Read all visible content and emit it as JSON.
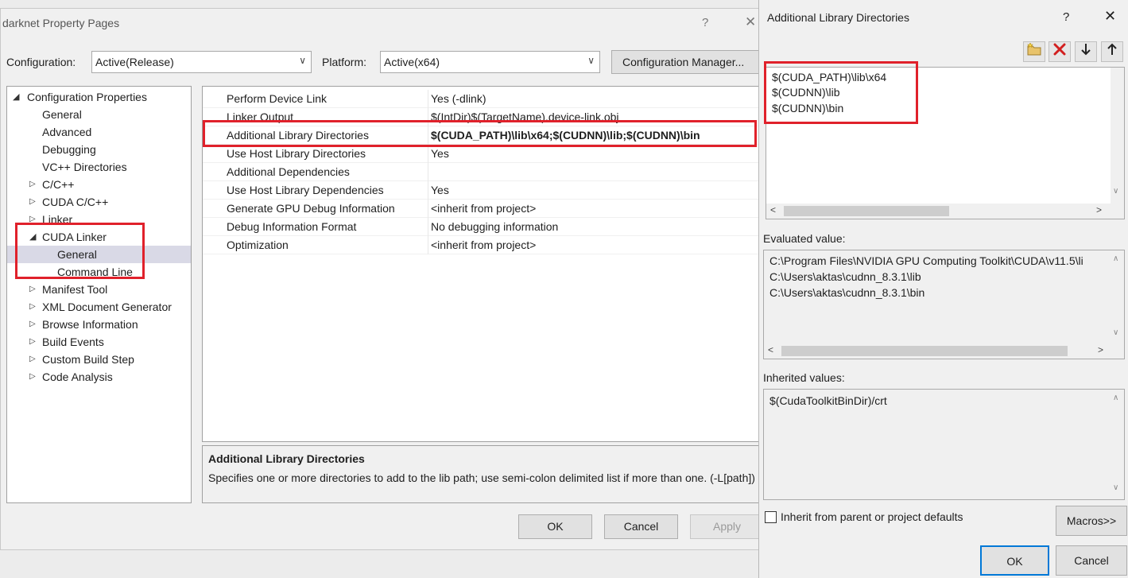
{
  "property_pages": {
    "title": "darknet Property Pages",
    "help": "?",
    "close": "✕",
    "config_label": "Configuration:",
    "config_value": "Active(Release)",
    "platform_label": "Platform:",
    "platform_value": "Active(x64)",
    "config_manager": "Configuration Manager...",
    "tree": [
      {
        "label": "Configuration Properties",
        "indent": 0,
        "toggle": "expanded"
      },
      {
        "label": "General",
        "indent": 1,
        "toggle": "none"
      },
      {
        "label": "Advanced",
        "indent": 1,
        "toggle": "none"
      },
      {
        "label": "Debugging",
        "indent": 1,
        "toggle": "none"
      },
      {
        "label": "VC++ Directories",
        "indent": 1,
        "toggle": "none"
      },
      {
        "label": "C/C++",
        "indent": 1,
        "toggle": "collapsed"
      },
      {
        "label": "CUDA C/C++",
        "indent": 1,
        "toggle": "collapsed"
      },
      {
        "label": "Linker",
        "indent": 1,
        "toggle": "collapsed"
      },
      {
        "label": "CUDA Linker",
        "indent": 1,
        "toggle": "expanded"
      },
      {
        "label": "General",
        "indent": 2,
        "toggle": "none",
        "selected": true
      },
      {
        "label": "Command Line",
        "indent": 2,
        "toggle": "none"
      },
      {
        "label": "Manifest Tool",
        "indent": 1,
        "toggle": "collapsed"
      },
      {
        "label": "XML Document Generator",
        "indent": 1,
        "toggle": "collapsed"
      },
      {
        "label": "Browse Information",
        "indent": 1,
        "toggle": "collapsed"
      },
      {
        "label": "Build Events",
        "indent": 1,
        "toggle": "collapsed"
      },
      {
        "label": "Custom Build Step",
        "indent": 1,
        "toggle": "collapsed"
      },
      {
        "label": "Code Analysis",
        "indent": 1,
        "toggle": "collapsed"
      }
    ],
    "properties": [
      {
        "name": "Perform Device Link",
        "value": "Yes (-dlink)"
      },
      {
        "name": "Linker Output",
        "value": "$(IntDir)$(TargetName).device-link.obj"
      },
      {
        "name": "Additional Library Directories",
        "value": "$(CUDA_PATH)\\lib\\x64;$(CUDNN)\\lib;$(CUDNN)\\bin",
        "bold": true
      },
      {
        "name": "Use Host Library Directories",
        "value": "Yes"
      },
      {
        "name": "Additional Dependencies",
        "value": ""
      },
      {
        "name": "Use Host Library Dependencies",
        "value": "Yes"
      },
      {
        "name": "Generate GPU Debug Information",
        "value": "<inherit from project>"
      },
      {
        "name": "Debug Information Format",
        "value": "No debugging information"
      },
      {
        "name": "Optimization",
        "value": "<inherit from project>"
      }
    ],
    "description": {
      "title": "Additional Library Directories",
      "text": "Specifies one or more directories to add to the lib path; use semi-colon delimited list if more than one. (-L[path])"
    },
    "ok": "OK",
    "cancel": "Cancel",
    "apply": "Apply"
  },
  "ald_dialog": {
    "title": "Additional Library Directories",
    "help": "?",
    "close": "✕",
    "toolbar_icons": [
      "new-folder-icon",
      "delete-icon",
      "move-down-icon",
      "move-up-icon"
    ],
    "entries": [
      "$(CUDA_PATH)\\lib\\x64",
      "$(CUDNN)\\lib",
      "$(CUDNN)\\bin"
    ],
    "evaluated_label": "Evaluated value:",
    "evaluated": [
      "C:\\Program Files\\NVIDIA GPU Computing Toolkit\\CUDA\\v11.5\\li",
      "C:\\Users\\aktas\\cudnn_8.3.1\\lib",
      "C:\\Users\\aktas\\cudnn_8.3.1\\bin"
    ],
    "inherited_label": "Inherited values:",
    "inherited": [
      "$(CudaToolkitBinDir)/crt"
    ],
    "inherit_checkbox": "Inherit from parent or project defaults",
    "inherit_checked": false,
    "macros": "Macros>>",
    "ok": "OK",
    "cancel": "Cancel"
  },
  "colors": {
    "highlight": "#e0212b",
    "selection": "#d9d9e6",
    "default_button": "#0078d7"
  }
}
